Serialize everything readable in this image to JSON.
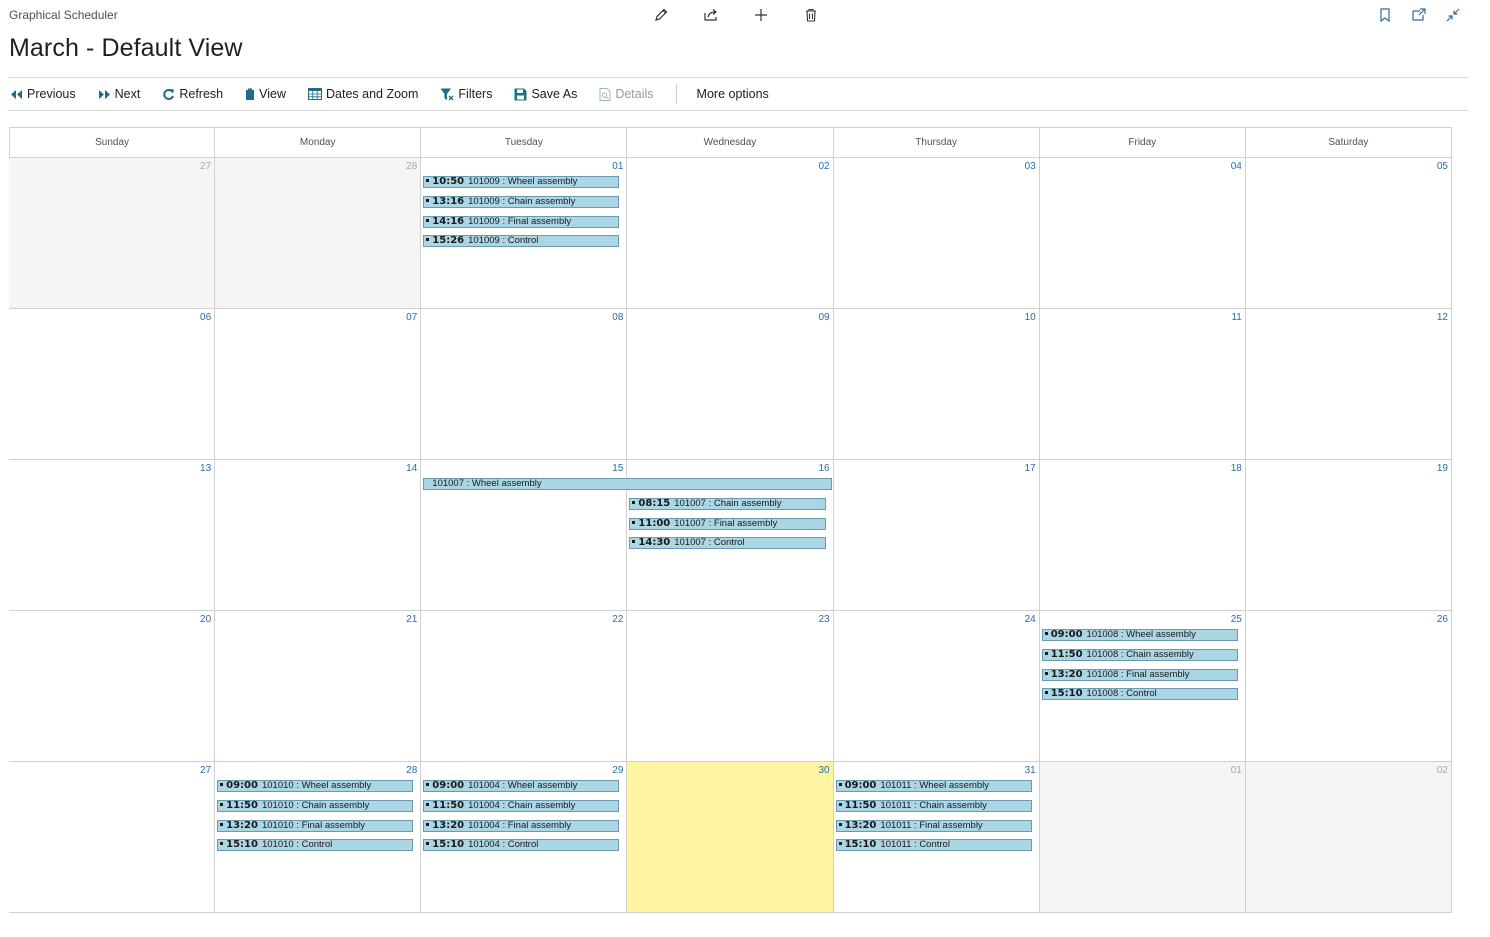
{
  "app": {
    "name": "Graphical Scheduler"
  },
  "page": {
    "title": "March - Default View"
  },
  "toolbar": {
    "previous": "Previous",
    "next": "Next",
    "refresh": "Refresh",
    "view": "View",
    "dates_zoom": "Dates and Zoom",
    "filters": "Filters",
    "save_as": "Save As",
    "details": "Details",
    "more": "More options"
  },
  "colors": {
    "accent": "#2a6cae",
    "event_fill": "#abd6e4",
    "event_border": "#6b9ab0",
    "today": "#fef4a2",
    "other_month": "#f5f5f5"
  },
  "icons": {
    "top": [
      "pencil-icon",
      "share-icon",
      "plus-icon",
      "trash-icon"
    ],
    "right": [
      "bookmark-icon",
      "open-new-window-icon",
      "collapse-icon"
    ]
  },
  "calendar": {
    "weekdays": [
      "Sunday",
      "Monday",
      "Tuesday",
      "Wednesday",
      "Thursday",
      "Friday",
      "Saturday"
    ],
    "weeks": [
      {
        "days": [
          {
            "n": "27",
            "other": true
          },
          {
            "n": "28",
            "other": true
          },
          {
            "n": "01"
          },
          {
            "n": "02"
          },
          {
            "n": "03"
          },
          {
            "n": "04"
          },
          {
            "n": "05"
          }
        ],
        "events": [
          {
            "col": 2,
            "slot": 0,
            "time": "10:50",
            "text": "101009 : Wheel assembly"
          },
          {
            "col": 2,
            "slot": 1,
            "time": "13:16",
            "text": "101009 : Chain assembly"
          },
          {
            "col": 2,
            "slot": 2,
            "time": "14:16",
            "text": "101009 : Final assembly"
          },
          {
            "col": 2,
            "slot": 3,
            "time": "15:26",
            "text": "101009 : Control"
          }
        ]
      },
      {
        "days": [
          {
            "n": "06"
          },
          {
            "n": "07"
          },
          {
            "n": "08"
          },
          {
            "n": "09"
          },
          {
            "n": "10"
          },
          {
            "n": "11"
          },
          {
            "n": "12"
          }
        ],
        "events": []
      },
      {
        "days": [
          {
            "n": "13"
          },
          {
            "n": "14"
          },
          {
            "n": "15"
          },
          {
            "n": "16"
          },
          {
            "n": "17"
          },
          {
            "n": "18"
          },
          {
            "n": "19"
          }
        ],
        "events": [
          {
            "col": 2,
            "span": 2,
            "slot": 0,
            "time": "",
            "text": "101007 : Wheel assembly"
          },
          {
            "col": 3,
            "slot": 1,
            "time": "08:15",
            "text": "101007 : Chain assembly"
          },
          {
            "col": 3,
            "slot": 2,
            "time": "11:00",
            "text": "101007 : Final assembly"
          },
          {
            "col": 3,
            "slot": 3,
            "time": "14:30",
            "text": "101007 : Control"
          }
        ]
      },
      {
        "days": [
          {
            "n": "20"
          },
          {
            "n": "21"
          },
          {
            "n": "22"
          },
          {
            "n": "23"
          },
          {
            "n": "24"
          },
          {
            "n": "25"
          },
          {
            "n": "26"
          }
        ],
        "events": [
          {
            "col": 5,
            "slot": 0,
            "time": "09:00",
            "text": "101008 : Wheel assembly"
          },
          {
            "col": 5,
            "slot": 1,
            "time": "11:50",
            "text": "101008 : Chain assembly"
          },
          {
            "col": 5,
            "slot": 2,
            "time": "13:20",
            "text": "101008 : Final assembly"
          },
          {
            "col": 5,
            "slot": 3,
            "time": "15:10",
            "text": "101008 : Control"
          }
        ]
      },
      {
        "days": [
          {
            "n": "27"
          },
          {
            "n": "28"
          },
          {
            "n": "29"
          },
          {
            "n": "30",
            "today": true
          },
          {
            "n": "31"
          },
          {
            "n": "01",
            "other": true
          },
          {
            "n": "02",
            "other": true
          }
        ],
        "events": [
          {
            "col": 1,
            "slot": 0,
            "time": "09:00",
            "text": "101010 : Wheel assembly"
          },
          {
            "col": 1,
            "slot": 1,
            "time": "11:50",
            "text": "101010 : Chain assembly"
          },
          {
            "col": 1,
            "slot": 2,
            "time": "13:20",
            "text": "101010 : Final assembly"
          },
          {
            "col": 1,
            "slot": 3,
            "time": "15:10",
            "text": "101010 : Control"
          },
          {
            "col": 2,
            "slot": 0,
            "time": "09:00",
            "text": "101004 : Wheel assembly"
          },
          {
            "col": 2,
            "slot": 1,
            "time": "11:50",
            "text": "101004 : Chain assembly"
          },
          {
            "col": 2,
            "slot": 2,
            "time": "13:20",
            "text": "101004 : Final assembly"
          },
          {
            "col": 2,
            "slot": 3,
            "time": "15:10",
            "text": "101004 : Control"
          },
          {
            "col": 4,
            "slot": 0,
            "time": "09:00",
            "text": "101011 : Wheel assembly"
          },
          {
            "col": 4,
            "slot": 1,
            "time": "11:50",
            "text": "101011 : Chain assembly"
          },
          {
            "col": 4,
            "slot": 2,
            "time": "13:20",
            "text": "101011 : Final assembly"
          },
          {
            "col": 4,
            "slot": 3,
            "time": "15:10",
            "text": "101011 : Control"
          }
        ]
      }
    ]
  }
}
